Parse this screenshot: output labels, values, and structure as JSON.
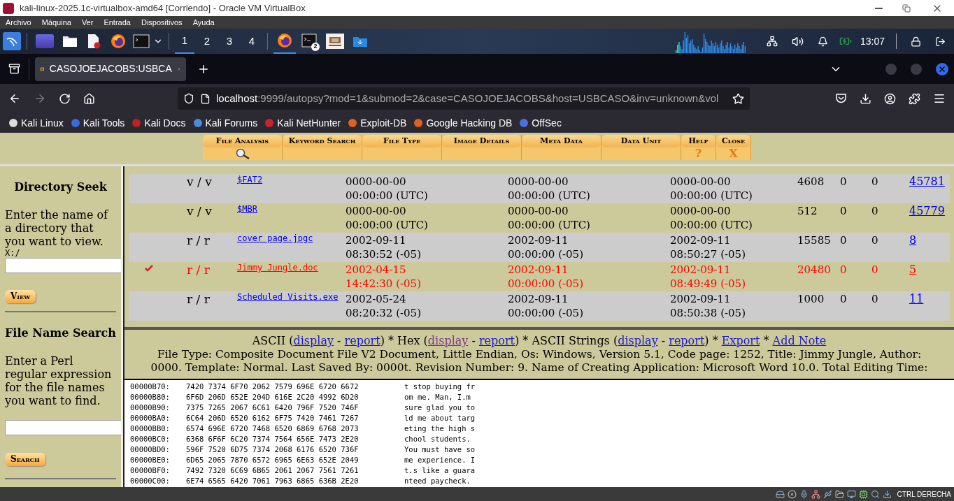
{
  "vm_window": {
    "title": "kali-linux-2025.1c-virtualbox-amd64 [Corriendo] - Oracle VM VirtualBox"
  },
  "vm_menu": [
    "Archivo",
    "Máquina",
    "Ver",
    "Entrada",
    "Dispositivos",
    "Ayuda"
  ],
  "panel": {
    "workspaces": [
      {
        "label": "1",
        "selected": true
      },
      {
        "label": "2",
        "selected": false
      },
      {
        "label": "3",
        "selected": false
      },
      {
        "label": "4",
        "selected": false
      }
    ],
    "tasks": [
      {
        "kind": "firefox",
        "selected": true
      },
      {
        "kind": "terminal",
        "selected": false,
        "badge": "2"
      },
      {
        "kind": "picture",
        "selected": false
      },
      {
        "kind": "download",
        "selected": false
      }
    ],
    "clock": "13:07"
  },
  "browser": {
    "tab": {
      "title": "CASOJOEJACOBS:USBCA",
      "selected": true
    },
    "url": {
      "host": "localhost",
      "rest": ":9999/autopsy?mod=1&submod=2&case=CASOJOEJACOBS&host=USBCASO&inv=unknown&vol"
    },
    "bookmarks": [
      "Kali Linux",
      "Kali Tools",
      "Kali Docs",
      "Kali Forums",
      "Kali NetHunter",
      "Exploit-DB",
      "Google Hacking DB",
      "OffSec"
    ]
  },
  "autopsy_tabs": [
    {
      "label": "File Analysis",
      "kind": "search"
    },
    {
      "label": "Keyword Search",
      "kind": "plain"
    },
    {
      "label": "File Type",
      "kind": "plain"
    },
    {
      "label": "Image Details",
      "kind": "plain"
    },
    {
      "label": "Meta Data",
      "kind": "plain"
    },
    {
      "label": "Data Unit",
      "kind": "plain"
    },
    {
      "label": "Help",
      "kind": "glyph",
      "glyph": "?"
    },
    {
      "label": "Close",
      "kind": "glyph",
      "glyph": "X"
    }
  ],
  "sidebar": {
    "directory_seek": {
      "title": "Directory Seek",
      "description": "Enter the name of a directory that you want to view.",
      "path_label": "X:/",
      "button": "View"
    },
    "file_name_search": {
      "title": "File Name Search",
      "description": "Enter a Perl regular expression for the file names you want to find.",
      "button": "Search"
    }
  },
  "files": [
    {
      "type": "v / v",
      "name": "$FAT2",
      "date_1": [
        "0000-00-00",
        "00:00:00 (UTC)"
      ],
      "date_2": [
        "0000-00-00",
        "00:00:00 (UTC)"
      ],
      "date_3": [
        "0000-00-00",
        "00:00:00 (UTC)"
      ],
      "column_7": "4608",
      "column_8": "0",
      "column_9": "0",
      "column_10": "45781",
      "deleted": false
    },
    {
      "type": "v / v",
      "name": "$MBR",
      "date_1": [
        "0000-00-00",
        "00:00:00 (UTC)"
      ],
      "date_2": [
        "0000-00-00",
        "00:00:00 (UTC)"
      ],
      "date_3": [
        "0000-00-00",
        "00:00:00 (UTC)"
      ],
      "column_7": "512",
      "column_8": "0",
      "column_9": "0",
      "column_10": "45779",
      "deleted": false
    },
    {
      "type": "r / r",
      "name": "cover page.jpgc",
      "date_1": [
        "2002-09-11",
        "08:30:52 (-05)"
      ],
      "date_2": [
        "2002-09-11",
        "00:00:00 (-05)"
      ],
      "date_3": [
        "2002-09-11",
        "08:50:27 (-05)"
      ],
      "column_7": "15585",
      "column_8": "0",
      "column_9": "0",
      "column_10": "8",
      "deleted": false
    },
    {
      "type": "r / r",
      "name": "Jimmy Jungle.doc",
      "date_1": [
        "2002-04-15",
        "14:42:30 (-05)"
      ],
      "date_2": [
        "2002-09-11",
        "00:00:00 (-05)"
      ],
      "date_3": [
        "2002-09-11",
        "08:49:49 (-05)"
      ],
      "column_7": "20480",
      "column_8": "0",
      "column_9": "0",
      "column_10": "5",
      "deleted": true
    },
    {
      "type": "r / r",
      "name": "Scheduled Visits.exe",
      "date_1": [
        "2002-05-24",
        "08:20:32 (-05)"
      ],
      "date_2": [
        "2002-09-11",
        "00:00:00 (-05)"
      ],
      "date_3": [
        "2002-09-11",
        "08:50:38 (-05)"
      ],
      "column_7": "1000",
      "column_8": "0",
      "column_9": "0",
      "column_10": "11",
      "deleted": false
    }
  ],
  "viewer": {
    "links": [
      {
        "kind": "text",
        "text": "ASCII ("
      },
      {
        "kind": "link",
        "text": "display",
        "visited": false
      },
      {
        "kind": "text",
        "text": " - "
      },
      {
        "kind": "link",
        "text": "report",
        "visited": false
      },
      {
        "kind": "text",
        "text": ") * Hex ("
      },
      {
        "kind": "link",
        "text": "display",
        "visited": true
      },
      {
        "kind": "text",
        "text": " - "
      },
      {
        "kind": "link",
        "text": "report",
        "visited": false
      },
      {
        "kind": "text",
        "text": ") * ASCII Strings ("
      },
      {
        "kind": "link",
        "text": "display",
        "visited": false
      },
      {
        "kind": "text",
        "text": " - "
      },
      {
        "kind": "link",
        "text": "report",
        "visited": false
      },
      {
        "kind": "text",
        "text": ") * "
      },
      {
        "kind": "link",
        "text": "Export",
        "visited": false
      },
      {
        "kind": "text",
        "text": " * "
      },
      {
        "kind": "link",
        "text": "Add Note",
        "visited": false
      }
    ],
    "file_info": [
      "File Type: Composite Document File V2 Document, Little Endian, Os: Windows, Version 5.1, Code page: 1252, Title: Jimmy Jungle, Author:",
      "0000. Template: Normal. Last Saved By: 0000t. Revision Number: 9. Name of Creating Application: Microsoft Word 10.0. Total Editing Time:"
    ],
    "hex_rows": [
      {
        "offset": "00000B70:",
        "hex": "7420 7374 6F70 2062 7579 696E 6720 6672",
        "ascii": "t stop buying fr"
      },
      {
        "offset": "00000B80:",
        "hex": "6F6D 206D 652E 204D 616E 2C20 4992 6D20",
        "ascii": "om me. Man, I.m"
      },
      {
        "offset": "00000B90:",
        "hex": "7375 7265 2067 6C61 6420 796F 7520 746F",
        "ascii": "sure glad you to"
      },
      {
        "offset": "00000BA0:",
        "hex": "6C64 206D 6520 6162 6F75 7420 7461 7267",
        "ascii": "ld me about targ"
      },
      {
        "offset": "00000BB0:",
        "hex": "6574 696E 6720 7468 6520 6869 6768 2073",
        "ascii": "eting the high s"
      },
      {
        "offset": "00000BC0:",
        "hex": "6368 6F6F 6C20 7374 7564 656E 7473 2E20",
        "ascii": "chool students."
      },
      {
        "offset": "00000BD0:",
        "hex": "596F 7520 6D75 7374 2068 6176 6520 736F",
        "ascii": "You must have so"
      },
      {
        "offset": "00000BE0:",
        "hex": "6D65 2065 7870 6572 6965 6E63 652E 2049",
        "ascii": "me experience. I"
      },
      {
        "offset": "00000BF0:",
        "hex": "7492 7320 6C69 6B65 2061 2067 7561 7261",
        "ascii": "t.s like a guara"
      },
      {
        "offset": "00000C00:",
        "hex": "6E74 6565 6420 7061 7963 6865 636B 2E20",
        "ascii": "nteed paycheck."
      }
    ]
  },
  "status_bar": {
    "host_key": "CTRL DERECHA"
  }
}
